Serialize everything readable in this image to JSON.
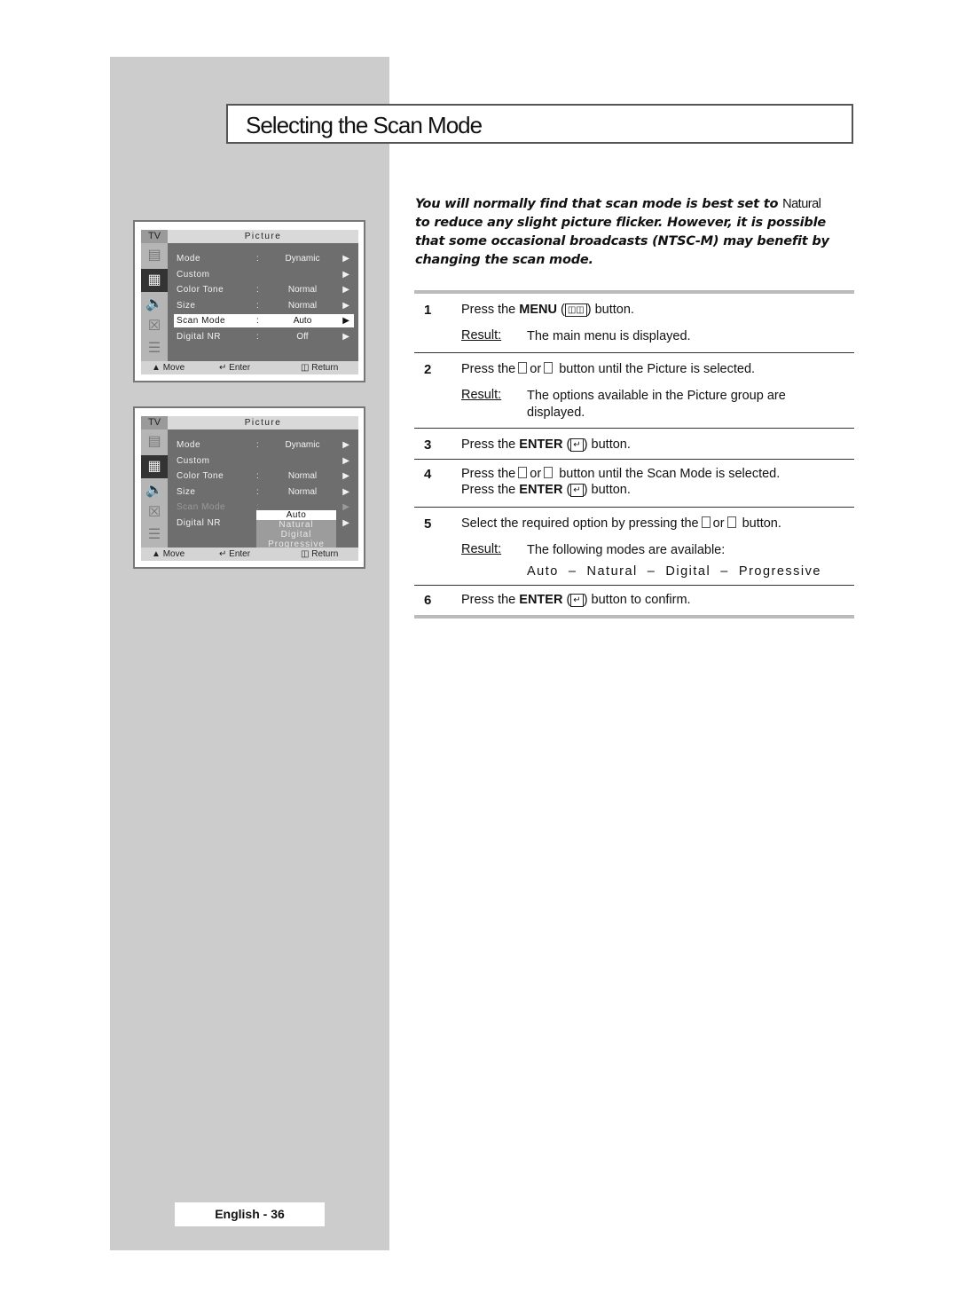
{
  "page": {
    "title": "Selecting the Scan Mode",
    "page_label": "English - 36"
  },
  "intro": {
    "before": "You will normally find that scan mode is best set to",
    "highlight": "Natural",
    "after": "to reduce any slight picture flicker. However, it is possible that some occasional broadcasts (NTSC-M) may benefit by changing the scan mode."
  },
  "osd": {
    "tv_label": "TV",
    "header": "Picture",
    "icons": [
      "input-icon",
      "picture-icon",
      "sound-icon",
      "channel-icon",
      "setup-icon"
    ],
    "rows": [
      {
        "label": "Mode",
        "sep": ":",
        "value": "Dynamic"
      },
      {
        "label": "Custom",
        "sep": "",
        "value": ""
      },
      {
        "label": "Color Tone",
        "sep": ":",
        "value": "Normal"
      },
      {
        "label": "Size",
        "sep": ":",
        "value": "Normal"
      },
      {
        "label": "Scan Mode",
        "sep": ":",
        "value": "Auto"
      },
      {
        "label": "Digital NR",
        "sep": ":",
        "value": "Off"
      }
    ],
    "footer": {
      "move": "Move",
      "enter": "Enter",
      "return": "Return"
    },
    "dropdown_options": [
      "Auto",
      "Natural",
      "Digital",
      "Progressive"
    ],
    "dropdown_selected": "Auto"
  },
  "steps": [
    {
      "num": "1",
      "pre": "Press the ",
      "bold": "MENU",
      "post": " button.",
      "result_label": "Result:",
      "result": "The main menu is displayed."
    },
    {
      "num": "2",
      "text": "button until the Picture is selected.",
      "pre": "Press the",
      "or": "or",
      "result_label": "Result:",
      "result": "The options available in the Picture group are displayed."
    },
    {
      "num": "3",
      "pre": "Press the ",
      "bold": "ENTER",
      "post": " button."
    },
    {
      "num": "4",
      "pre": "Press the",
      "or": "or",
      "text": "button until the Scan Mode is selected.",
      "line2_pre": "Press the ",
      "line2_bold": "ENTER",
      "line2_post": " button."
    },
    {
      "num": "5",
      "pre": "Select the required option by pressing the",
      "or": "or",
      "text": "button.",
      "result_label": "Result:",
      "result": "The following modes are available:",
      "modes": "Auto  –  Natural  –  Digital  –  Progressive"
    },
    {
      "num": "6",
      "pre": "Press the ",
      "bold": "ENTER",
      "post": " button to confirm."
    }
  ]
}
